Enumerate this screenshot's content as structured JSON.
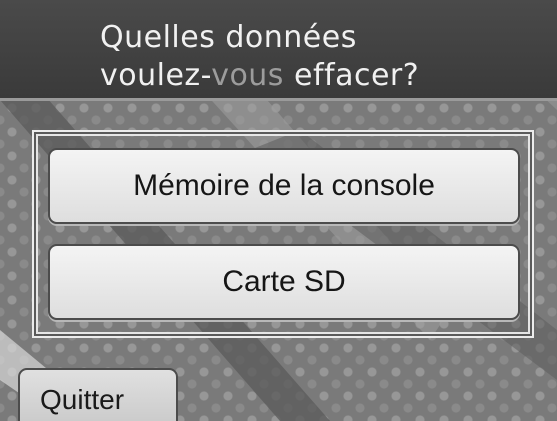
{
  "header": {
    "line1": "Quelles données",
    "line2_a": "voulez-",
    "line2_b": "vous",
    "line2_c": " effacer?"
  },
  "options": [
    {
      "label": "Mémoire de la console"
    },
    {
      "label": "Carte SD"
    }
  ],
  "footer": {
    "quit_label": "Quitter"
  }
}
